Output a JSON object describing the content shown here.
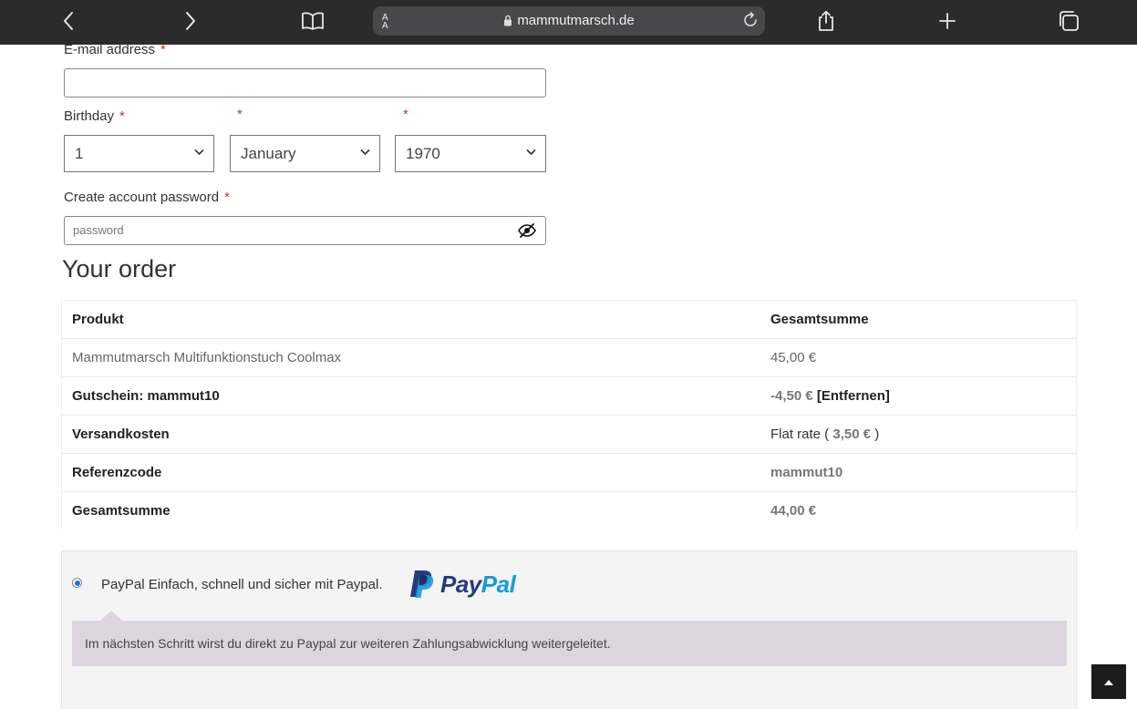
{
  "browser": {
    "text_size_label": "A\nA",
    "url": "mammutmarsch.de"
  },
  "form": {
    "email_label": "E-mail address",
    "required_mark": "*",
    "email_value": "",
    "birthday_label": "Birthday",
    "birthday_day": "1",
    "birthday_month": "January",
    "birthday_year": "1970",
    "password_label": "Create account password",
    "password_placeholder": "password"
  },
  "order": {
    "title": "Your order",
    "header_product": "Produkt",
    "header_total": "Gesamtsumme",
    "rows": [
      {
        "label": "Mammutmarsch Multifunktionstuch Coolmax",
        "value": "45,00 €"
      },
      {
        "label": "Gutschein: mammut10",
        "value": "-4,50 €",
        "remove": "[Entfernen]"
      },
      {
        "label": "Versandkosten",
        "value_prefix": "Flat rate (",
        "value": "3,50 €",
        "value_suffix": ")"
      },
      {
        "label": "Referenzcode",
        "value": "mammut10"
      },
      {
        "label": "Gesamtsumme",
        "value": "44,00 €"
      }
    ]
  },
  "payment": {
    "paypal_label": "PayPal Einfach, schnell und sicher mit Paypal.",
    "paypal_logo_pay": "Pay",
    "paypal_logo_pal": "Pal",
    "paypal_info": "Im nächsten Schritt wirst du direkt zu Paypal zur weiteren Zahlungsabwicklung weitergeleitet."
  },
  "colors": {
    "toolbar": "#2b2b2b",
    "paypal_dark": "#253b80",
    "paypal_light": "#179bd7",
    "info_box": "#dcd5e0"
  }
}
